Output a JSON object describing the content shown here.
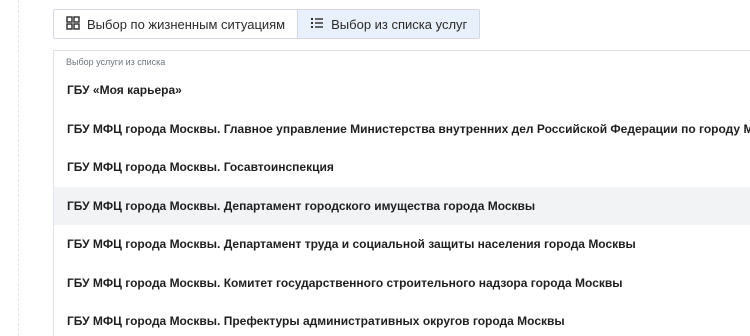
{
  "view_switcher": {
    "situations_label": "Выбор по жизненным ситуациям",
    "services_label": "Выбор из списка услуг",
    "active": "services"
  },
  "service_list": {
    "caption": "Выбор услуги из списка",
    "items": [
      {
        "label": "ГБУ «Моя карьера»"
      },
      {
        "label": "ГБУ МФЦ города Москвы. Главное управление Министерства внутренних дел Российской Федерации по городу Москве"
      },
      {
        "label": "ГБУ МФЦ города Москвы. Госавтоинспекция"
      },
      {
        "label": "ГБУ МФЦ города Москвы. Департамент городского имущества города Москвы"
      },
      {
        "label": "ГБУ МФЦ города Москвы. Департамент труда и социальной защиты населения города Москвы"
      },
      {
        "label": "ГБУ МФЦ города Москвы. Комитет государственного строительного надзора города Москвы"
      },
      {
        "label": "ГБУ МФЦ города Москвы. Префектуры административных округов города Москвы"
      }
    ],
    "hovered_index": 3
  },
  "colors": {
    "active_tab_bg": "#e8f0fb",
    "hover_row_bg": "#f1f3f5",
    "border": "#d4d9df"
  }
}
